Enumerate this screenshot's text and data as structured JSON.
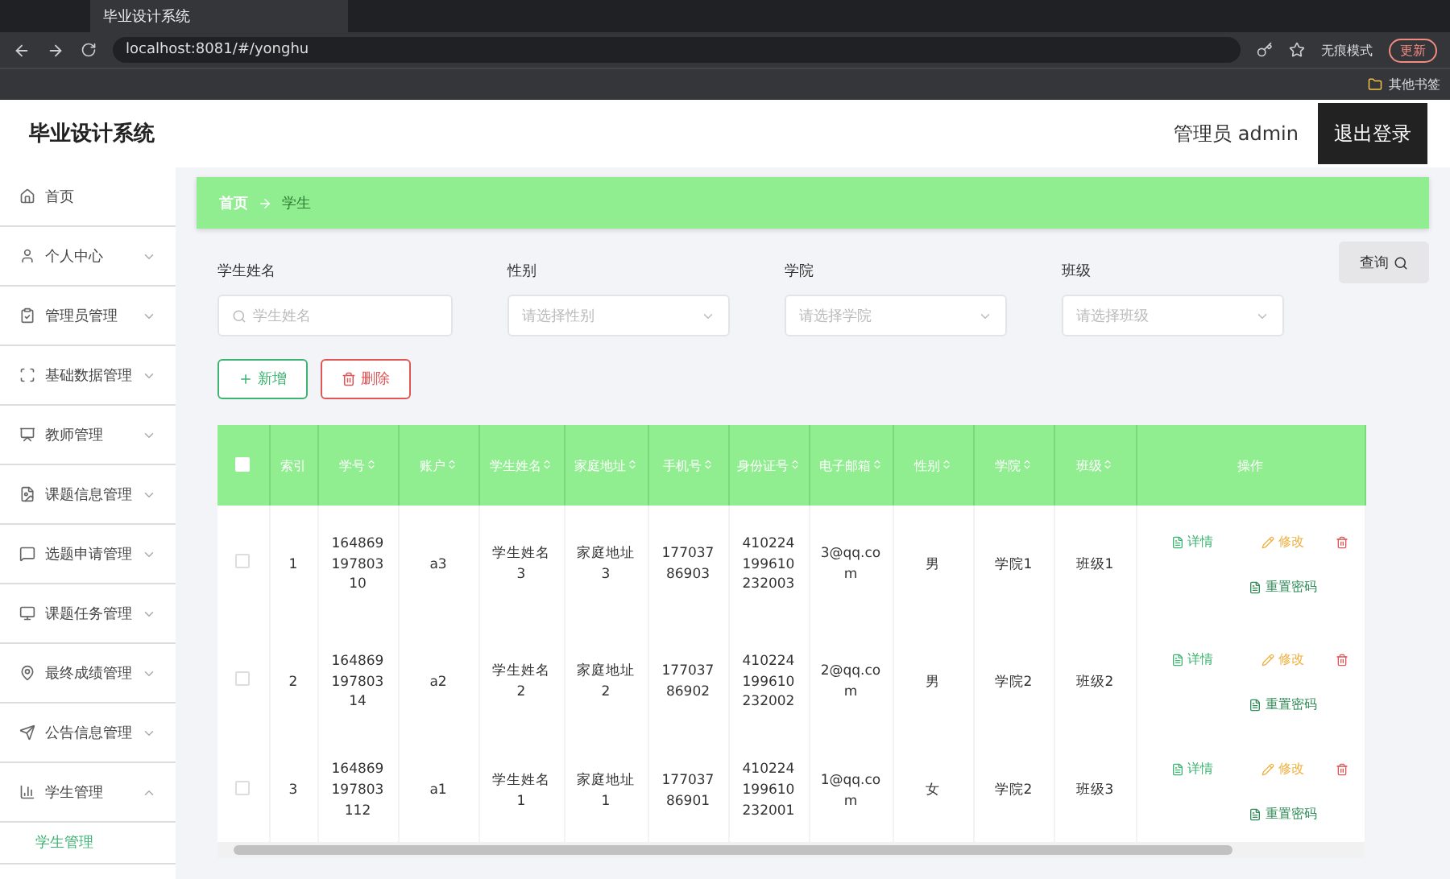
{
  "browser": {
    "tab_title": "毕业设计系统",
    "url": "localhost:8081/#/yonghu",
    "profile": "无痕模式",
    "update_button": "更新",
    "bookmarks_other": "其他书签"
  },
  "header": {
    "title": "毕业设计系统",
    "user": "管理员 admin",
    "logout": "退出登录"
  },
  "sidebar": {
    "items": [
      {
        "label": "首页",
        "kind": "link"
      },
      {
        "label": "个人中心",
        "kind": "menu",
        "expanded": false
      },
      {
        "label": "管理员管理",
        "kind": "menu",
        "expanded": false
      },
      {
        "label": "基础数据管理",
        "kind": "menu",
        "expanded": false
      },
      {
        "label": "教师管理",
        "kind": "menu",
        "expanded": false
      },
      {
        "label": "课题信息管理",
        "kind": "menu",
        "expanded": false
      },
      {
        "label": "选题申请管理",
        "kind": "menu",
        "expanded": false
      },
      {
        "label": "课题任务管理",
        "kind": "menu",
        "expanded": false
      },
      {
        "label": "最终成绩管理",
        "kind": "menu",
        "expanded": false
      },
      {
        "label": "公告信息管理",
        "kind": "menu",
        "expanded": false
      },
      {
        "label": "学生管理",
        "kind": "menu",
        "expanded": true,
        "children": [
          {
            "label": "学生管理",
            "selected": true
          }
        ]
      }
    ]
  },
  "breadcrumb": [
    "首页",
    "学生"
  ],
  "filters": [
    {
      "label": "学生姓名",
      "kind": "search",
      "placeholder": "学生姓名"
    },
    {
      "label": "性别",
      "kind": "select",
      "placeholder": "请选择性别"
    },
    {
      "label": "学院",
      "kind": "select",
      "placeholder": "请选择学院"
    },
    {
      "label": "班级",
      "kind": "select",
      "placeholder": "请选择班级"
    }
  ],
  "query_button": "查询",
  "actions": {
    "add": "新增",
    "delete": "删除"
  },
  "table": {
    "all_checked": false,
    "columns": [
      {
        "label": "索引",
        "sortable": false
      },
      {
        "label": "学号",
        "sortable": true
      },
      {
        "label": "账户",
        "sortable": true
      },
      {
        "label": "学生姓名",
        "sortable": true
      },
      {
        "label": "家庭地址",
        "sortable": true
      },
      {
        "label": "手机号",
        "sortable": true
      },
      {
        "label": "身份证号",
        "sortable": true
      },
      {
        "label": "电子邮箱",
        "sortable": true
      },
      {
        "label": "性别",
        "sortable": true
      },
      {
        "label": "学院",
        "sortable": true
      },
      {
        "label": "班级",
        "sortable": true
      },
      {
        "label": "操作",
        "sortable": false
      }
    ],
    "rows": [
      {
        "checked": false,
        "cells": [
          "1",
          "16486919780310",
          "a3",
          "学生姓名3",
          "家庭地址3",
          "17703786903",
          "410224199610232003",
          "3@qq.com",
          "男",
          "学院1",
          "班级1"
        ],
        "actions": {
          "detail": "详情",
          "edit": "修改",
          "reset": "重置密码"
        }
      },
      {
        "checked": false,
        "cells": [
          "2",
          "16486919780314",
          "a2",
          "学生姓名2",
          "家庭地址2",
          "17703786902",
          "410224199610232002",
          "2@qq.com",
          "男",
          "学院2",
          "班级2"
        ],
        "actions": {
          "detail": "详情",
          "edit": "修改",
          "reset": "重置密码"
        }
      },
      {
        "checked": false,
        "cells": [
          "3",
          "164869197803112",
          "a1",
          "学生姓名1",
          "家庭地址1",
          "17703786901",
          "410224199610232001",
          "1@qq.com",
          "女",
          "学院2",
          "班级3"
        ],
        "actions": {
          "detail": "详情",
          "edit": "修改",
          "reset": "重置密码"
        }
      }
    ]
  }
}
